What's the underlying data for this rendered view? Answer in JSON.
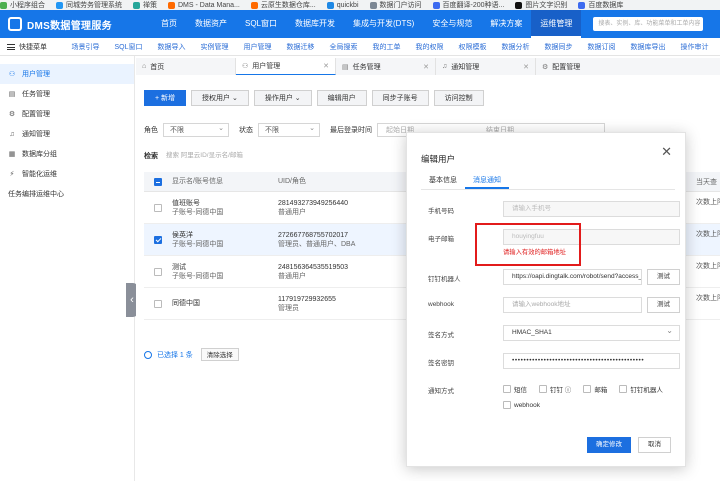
{
  "bookmarks": [
    "小程序组合",
    "同城劳务管理系统",
    "禅策",
    "DMS - Data Mana...",
    "云原生数据仓库...",
    "quickbi",
    "数据门户访问",
    "百度翻译-200种语...",
    "图片文字识别",
    "百度数据库"
  ],
  "nav": {
    "title": "DMS数据管理服务",
    "items": [
      "首页",
      "数据资产",
      "SQL窗口",
      "数据库开发",
      "集成与开发(DTS)",
      "安全与规范",
      "解决方案",
      "运维管理"
    ],
    "active": "运维管理",
    "search_placeholder": "搜表、实例、库、功能菜单和工单内容"
  },
  "subbar": {
    "quick_label": "快捷菜单",
    "items": [
      "场景引导",
      "SQL窗口",
      "数据导入",
      "实例管理",
      "用户管理",
      "数据迁移",
      "全局搜索",
      "我的工单",
      "我的权限",
      "权限模板",
      "数据分析",
      "数据同步",
      "数据订阅",
      "数据库导出",
      "操作审计"
    ]
  },
  "sidebar": {
    "items": [
      {
        "label": "用户管理",
        "icon": "user-icon",
        "glyph": "⚇"
      },
      {
        "label": "任务管理",
        "icon": "task-icon",
        "glyph": "▤"
      },
      {
        "label": "配置管理",
        "icon": "config-icon",
        "glyph": "⚙"
      },
      {
        "label": "通知管理",
        "icon": "bell-icon",
        "glyph": "♫"
      },
      {
        "label": "数据库分组",
        "icon": "database-group-icon",
        "glyph": "▦"
      },
      {
        "label": "智能化运维",
        "icon": "smart-ops-icon",
        "glyph": "⚡"
      },
      {
        "label": "任务编排运维中心",
        "icon": "",
        "glyph": ""
      }
    ]
  },
  "tabs": [
    {
      "label": "首页",
      "icon": "home-icon",
      "glyph": "⌂"
    },
    {
      "label": "用户管理",
      "icon": "user-icon",
      "glyph": "⚇"
    },
    {
      "label": "任务管理",
      "icon": "task-icon",
      "glyph": "▤"
    },
    {
      "label": "通知管理",
      "icon": "bell-icon",
      "glyph": "♫"
    },
    {
      "label": "配置管理",
      "icon": "config-icon",
      "glyph": "⚙"
    }
  ],
  "toolbar": {
    "add": "+ 新增",
    "grant": "授权用户 ⌄",
    "operate": "操作用户 ⌄",
    "edit": "编辑用户",
    "sync": "同步子账号",
    "access": "访问控制"
  },
  "filters": {
    "role_label": "角色",
    "role_value": "不限",
    "status_label": "状态",
    "status_value": "不限",
    "last_login_label": "最后登录时间",
    "start_date": "起始日期",
    "end_date": "结束日期",
    "keyword_label": "检索",
    "keyword_placeholder": "搜索 阿里云ID/显示名/邮箱"
  },
  "table": {
    "columns": [
      "显示名/账号信息",
      "UID/角色"
    ],
    "rows": [
      {
        "name": "值班账号",
        "sub": "子账号-同德中国",
        "uid": "281493273949256440",
        "role": "普通用户",
        "selected": false
      },
      {
        "name": "侯英洋",
        "sub": "子账号-同德中国",
        "uid": "272667768755702017",
        "role": "管理员、普通用户、DBA",
        "selected": true
      },
      {
        "name": "测试",
        "sub": "子账号-同德中国",
        "uid": "248156364535519503",
        "role": "普通用户",
        "selected": false
      },
      {
        "name": "同德中国",
        "sub": "",
        "uid": "117919729932655",
        "role": "管理员",
        "selected": false
      }
    ],
    "footer_selected_prefix": "已选择",
    "footer_selected_count": "1",
    "footer_selected_suffix": "条",
    "clear_selection": "清除选择"
  },
  "right_fragment": [
    "当天查",
    "次数上限",
    "次数上限",
    "次数上限",
    "次数上限"
  ],
  "modal": {
    "title": "编辑用户",
    "close": "✕",
    "tabs": [
      "基本信息",
      "消息通知"
    ],
    "active_tab": "消息通知",
    "fields": {
      "phone_label": "手机号码",
      "phone_placeholder": "请输入手机号",
      "email_label": "电子邮箱",
      "email_value": "houyingfuu",
      "email_error": "请输入有效的邮箱地址",
      "robot_label": "钉钉机器人",
      "robot_value": "https://oapi.dingtalk.com/robot/send?access_token=",
      "robot_test": "测试",
      "webhook_label": "webhook",
      "webhook_placeholder": "请输入webhook地址",
      "webhook_test": "测试",
      "sign_method_label": "签名方式",
      "sign_method_value": "HMAC_SHA1",
      "sign_key_label": "签名密钥",
      "sign_key_value": "••••••••••••••••••••••••••••••••••••••••••••••",
      "notify_label": "通知方式",
      "notify_options": [
        "短信",
        "钉钉 ⓘ",
        "邮箱",
        "钉钉机器人",
        "webhook"
      ]
    },
    "ok": "确定修改",
    "cancel": "取消"
  }
}
